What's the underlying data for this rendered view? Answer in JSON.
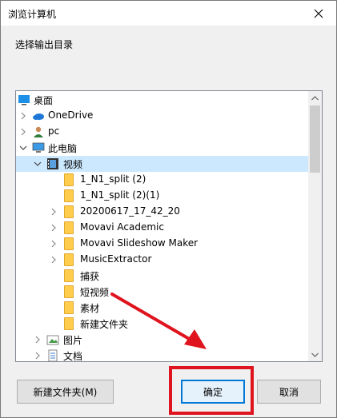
{
  "window": {
    "title": "浏览计算机"
  },
  "instruction": "选择输出目录",
  "tree": {
    "desktop": "桌面",
    "onedrive": "OneDrive",
    "pc_user": "pc",
    "this_pc": "此电脑",
    "videos": "视频",
    "folders": [
      "1_N1_split (2)",
      "1_N1_split (2)(1)",
      "20200617_17_42_20",
      "Movavi Academic",
      "Movavi Slideshow Maker",
      "MusicExtractor",
      "捕获",
      "短视频",
      "素材",
      "新建文件夹"
    ],
    "pictures": "图片",
    "documents": "文档"
  },
  "buttons": {
    "new_folder": "新建文件夹(M)",
    "ok": "确定",
    "cancel": "取消"
  },
  "colors": {
    "highlight": "#e0141e",
    "selection": "#cce8ff",
    "folder": "#ffcc4d"
  }
}
